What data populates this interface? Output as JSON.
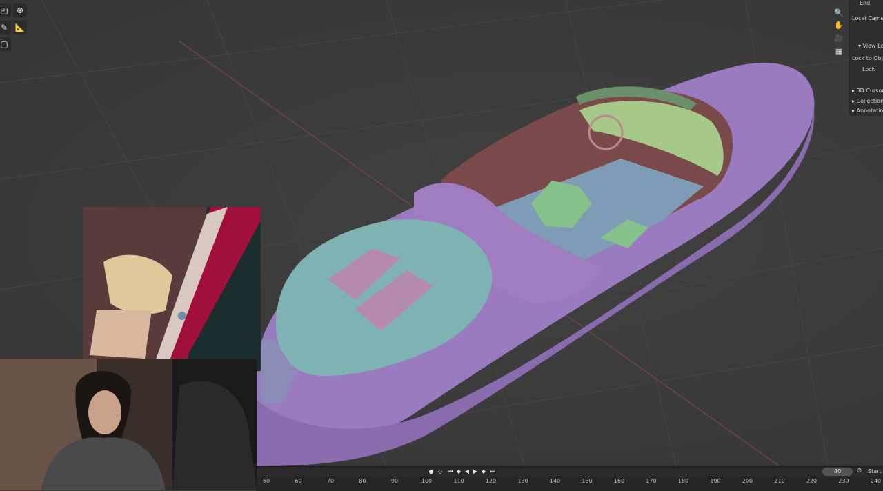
{
  "toolbar": {
    "tools": [
      {
        "icon": "scale-icon",
        "glyph": "◰"
      },
      {
        "icon": "transform-icon",
        "glyph": "⊕"
      },
      {
        "icon": "annotate-icon",
        "glyph": "✎"
      },
      {
        "icon": "measure-icon",
        "glyph": "📐"
      },
      {
        "icon": "add-cube-icon",
        "glyph": "▢"
      }
    ]
  },
  "navigation_gizmo": [
    {
      "icon": "zoom-icon",
      "glyph": "🔍"
    },
    {
      "icon": "pan-hand-icon",
      "glyph": "✋"
    },
    {
      "icon": "camera-view-icon",
      "glyph": "🎥"
    },
    {
      "icon": "perspective-grid-icon",
      "glyph": "▦"
    }
  ],
  "sidebar": {
    "end_label": "End",
    "local_camera_label": "Local Came",
    "view_lock_header": "View Loc",
    "lock_to_object_label": "Lock to Obj...",
    "lock_label": "Lock",
    "sections": [
      "3D Cursor",
      "Collection",
      "Annotation"
    ]
  },
  "timeline": {
    "current_frame": "40",
    "start_label": "Start",
    "playback_controls": [
      {
        "icon": "record-icon",
        "glyph": "●"
      },
      {
        "icon": "keyframe-icon",
        "glyph": "◇"
      },
      {
        "icon": "jump-start-icon",
        "glyph": "⏮"
      },
      {
        "icon": "prev-keyframe-icon",
        "glyph": "◆"
      },
      {
        "icon": "play-reverse-icon",
        "glyph": "◀"
      },
      {
        "icon": "play-icon",
        "glyph": "▶"
      },
      {
        "icon": "next-keyframe-icon",
        "glyph": "◆"
      },
      {
        "icon": "jump-end-icon",
        "glyph": "⏭"
      }
    ],
    "ruler_ticks": [
      "50",
      "60",
      "70",
      "80",
      "90",
      "100",
      "110",
      "120",
      "130",
      "140",
      "150",
      "160",
      "170",
      "180",
      "190",
      "200",
      "210",
      "220",
      "230",
      "240"
    ]
  },
  "colors": {
    "hull": "#9a7bbf",
    "deck_cover": "#7fb3b3",
    "cockpit_floor": "#7f9bb5",
    "wood": "#7a4a4a",
    "seat": "#86c08a"
  }
}
